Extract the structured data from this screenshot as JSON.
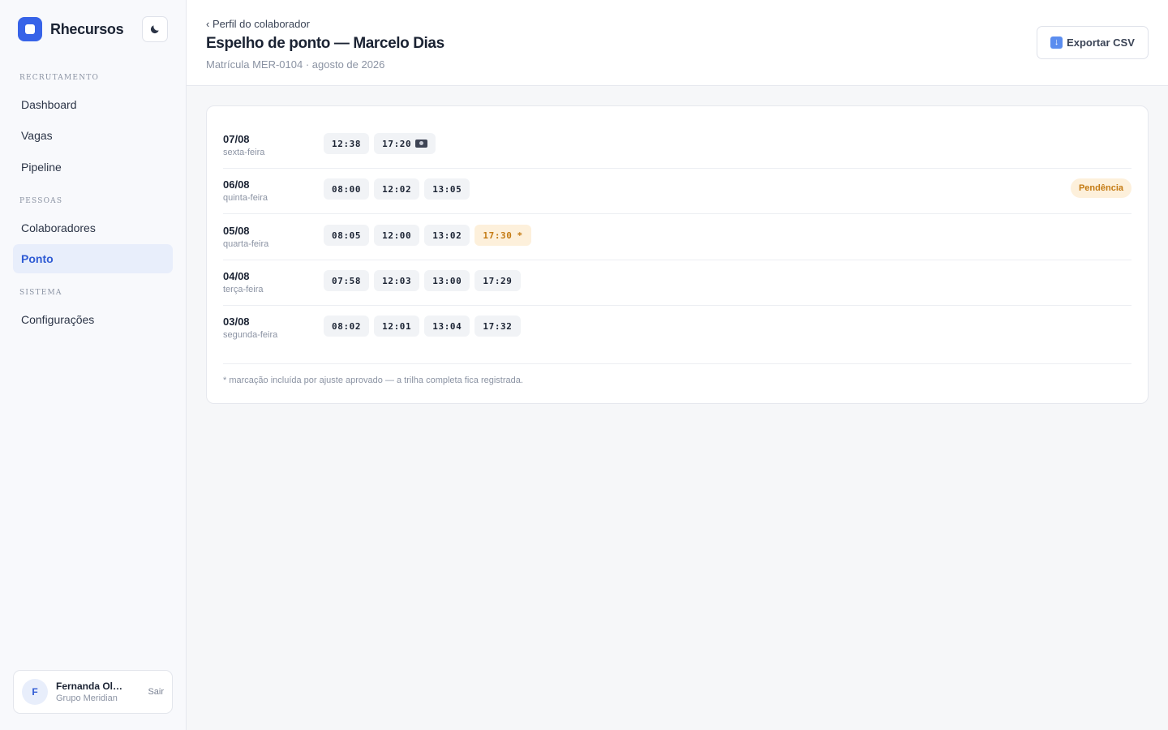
{
  "brand": {
    "name": "Rhecursos",
    "logo_icon": "square-logo-icon",
    "theme_icon": "moon-icon"
  },
  "sidebar": {
    "sections": [
      {
        "label": "RECRUTAMENTO",
        "items": [
          "Dashboard",
          "Vagas",
          "Pipeline"
        ]
      },
      {
        "label": "PESSOAS",
        "items": [
          "Colaboradores",
          "Ponto"
        ]
      },
      {
        "label": "SISTEMA",
        "items": [
          "Configurações"
        ]
      }
    ],
    "active_item": "Ponto"
  },
  "user": {
    "initial": "F",
    "name": "Fernanda Oliveira",
    "org": "Grupo Meridian",
    "logout_label": "Sair"
  },
  "header": {
    "back_label": "‹ Perfil do colaborador",
    "title": "Espelho de ponto — Marcelo Dias",
    "subtitle": "Matrícula MER-0104 · agosto de 2026",
    "export_label": "Exportar CSV",
    "export_icon": "download-icon"
  },
  "timesheet": {
    "rows": [
      {
        "date": "07/08",
        "weekday": "sexta-feira",
        "times": [
          {
            "value": "12:38"
          },
          {
            "value": "17:20",
            "icon": "camera-icon"
          }
        ],
        "badge": ""
      },
      {
        "date": "06/08",
        "weekday": "quinta-feira",
        "times": [
          {
            "value": "08:00"
          },
          {
            "value": "12:02"
          },
          {
            "value": "13:05"
          }
        ],
        "badge": "Pendência"
      },
      {
        "date": "05/08",
        "weekday": "quarta-feira",
        "times": [
          {
            "value": "08:05"
          },
          {
            "value": "12:00"
          },
          {
            "value": "13:02"
          },
          {
            "value": "17:30",
            "adjusted": true,
            "mark": "*"
          }
        ],
        "badge": ""
      },
      {
        "date": "04/08",
        "weekday": "terça-feira",
        "times": [
          {
            "value": "07:58"
          },
          {
            "value": "12:03"
          },
          {
            "value": "13:00"
          },
          {
            "value": "17:29"
          }
        ],
        "badge": ""
      },
      {
        "date": "03/08",
        "weekday": "segunda-feira",
        "times": [
          {
            "value": "08:02"
          },
          {
            "value": "12:01"
          },
          {
            "value": "13:04"
          },
          {
            "value": "17:32"
          }
        ],
        "badge": ""
      }
    ],
    "footnote": "* marcação incluída por ajuste aprovado — a trilha completa fica registrada."
  },
  "colors": {
    "accent": "#3763e8",
    "active_bg": "#e8eefb",
    "warning_bg": "#fdf0db",
    "warning_text": "#c47a12"
  }
}
